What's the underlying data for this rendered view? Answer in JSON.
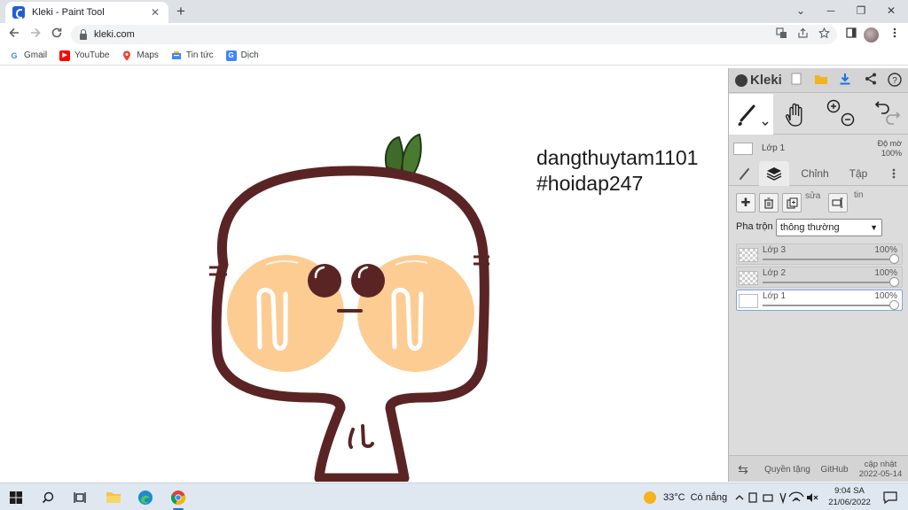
{
  "browser": {
    "tab_title": "Kleki - Paint Tool",
    "tab_close": "✕",
    "new_tab": "+",
    "url": "kleki.com",
    "window_controls": {
      "minimize": "─",
      "restore": "❐",
      "close": "✕",
      "tab_list": "⌄"
    },
    "bookmarks": [
      {
        "label": "Gmail",
        "icon": "google-icon"
      },
      {
        "label": "YouTube",
        "icon": "youtube-icon"
      },
      {
        "label": "Maps",
        "icon": "maps-icon"
      },
      {
        "label": "Tin tức",
        "icon": "news-icon"
      },
      {
        "label": "Dịch",
        "icon": "translate-icon"
      }
    ]
  },
  "canvas": {
    "text_line_1": "dangthuytam1101",
    "text_line_2": "#hoidap247",
    "colors": {
      "outline": "#5b2424",
      "cheek": "#fdcc93",
      "leaf": "#3f6b2a"
    }
  },
  "kleki": {
    "logo": "Kleki",
    "layer_name": "Lớp 1",
    "opacity_label": "Độ mờ",
    "opacity_value": "100%",
    "tabs": {
      "chinh": "Chỉnh",
      "tap": "Tập"
    },
    "layer_tool_labels": {
      "sua": "sửa",
      "tin": "tin"
    },
    "blend_label": "Pha trộn",
    "blend_value": "thông thường",
    "layers": [
      {
        "name": "Lớp 3",
        "opacity": "100%",
        "selected": false
      },
      {
        "name": "Lớp 2",
        "opacity": "100%",
        "selected": false
      },
      {
        "name": "Lớp 1",
        "opacity": "100%",
        "selected": true
      }
    ],
    "footer": {
      "swap": "⇆",
      "privacy": "Quyền tặng",
      "github": "GitHub",
      "update_label": "cập nhật",
      "update_date": "2022-05-14"
    },
    "accent": "#1a73e8"
  },
  "taskbar": {
    "weather_temp": "33°C",
    "weather_text": "Có nắng",
    "time": "9:04 SA",
    "date": "21/06/2022"
  }
}
